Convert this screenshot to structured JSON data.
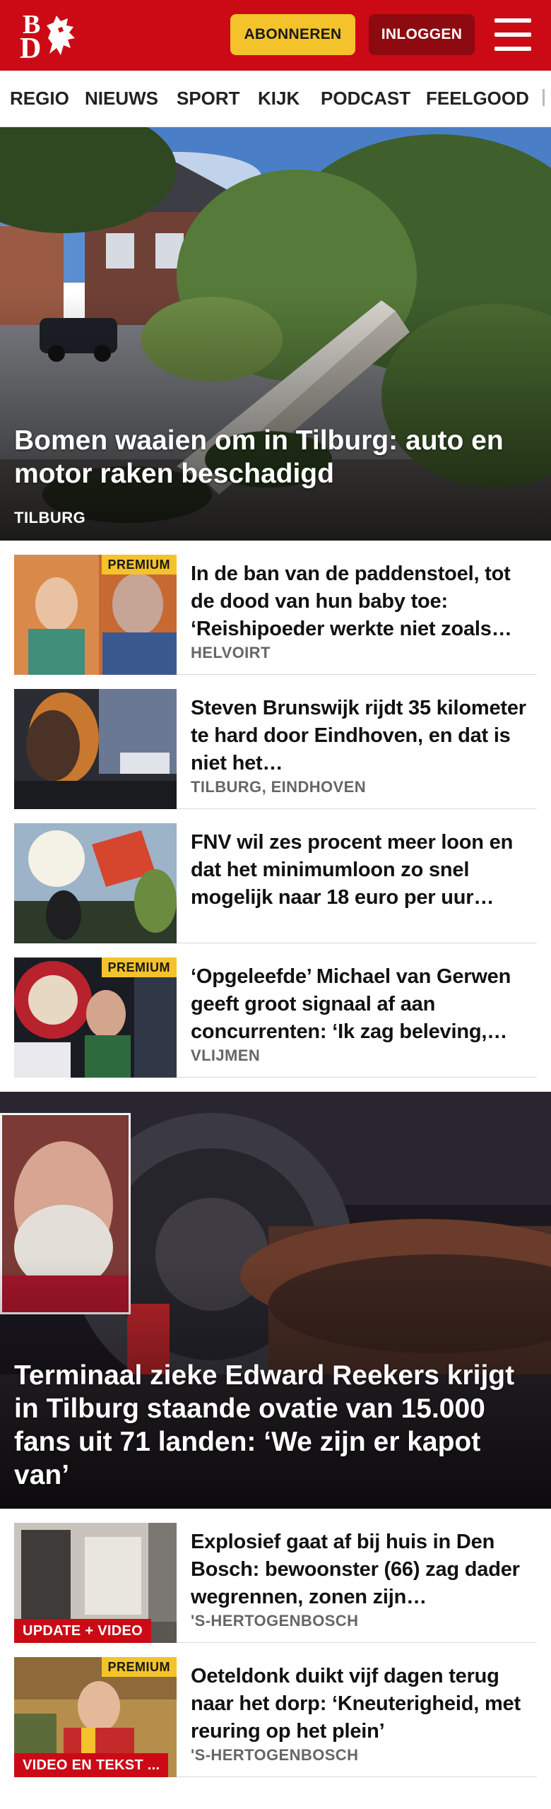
{
  "header": {
    "logo_top": "B",
    "logo_bottom": "D",
    "subscribe_label": "ABONNEREN",
    "login_label": "INLOGGEN",
    "menu_icon": "hamburger-menu-icon",
    "brand_color": "#cc0a16",
    "subscribe_color": "#f4c22b",
    "login_color": "#8d0a11"
  },
  "nav": {
    "items": [
      "REGIO",
      "NIEUWS",
      "SPORT",
      "KIJK",
      "PODCAST",
      "FEELGOOD"
    ]
  },
  "hero1": {
    "title": "Bomen waaien om in Tilburg: auto en motor raken beschadigd",
    "location": "TILBURG"
  },
  "articles": [
    {
      "title": "In de ban van de paddenstoel, tot de dood van hun baby toe: ‘Reishipoeder werkte niet zoals…",
      "location": "HELVOIRT",
      "badge": "PREMIUM"
    },
    {
      "title": "Steven Brunswijk rijdt 35 kilometer te hard door Eindhoven, en dat is niet het…",
      "location": "TILBURG, EINDHOVEN"
    },
    {
      "title": "FNV wil zes procent meer loon en dat het minimumloon zo snel mogelijk naar 18 euro per uur…"
    },
    {
      "title": "‘Opgeleefde’ Michael van Gerwen geeft groot signaal af aan concurrenten: ‘Ik zag beleving,…",
      "location": "VLIJMEN",
      "badge": "PREMIUM"
    }
  ],
  "hero2": {
    "title": "Terminaal zieke Edward Reekers krijgt in Tilburg staande ovatie van 15.000 fans uit 71 landen: ‘We zijn er kapot van’"
  },
  "articles2": [
    {
      "title": "Explosief gaat af bij huis in Den Bosch: bewoonster (66) zag dader wegrennen, zonen zijn…",
      "location": "'S-HERTOGENBOSCH",
      "label": "UPDATE + VIDEO"
    },
    {
      "title": "Oeteldonk duikt vijf dagen terug naar het dorp: ‘Kneuterigheid, met reuring op het plein’",
      "location": "'S-HERTOGENBOSCH",
      "badge": "PREMIUM",
      "label": "VIDEO EN TEKST ..."
    }
  ]
}
